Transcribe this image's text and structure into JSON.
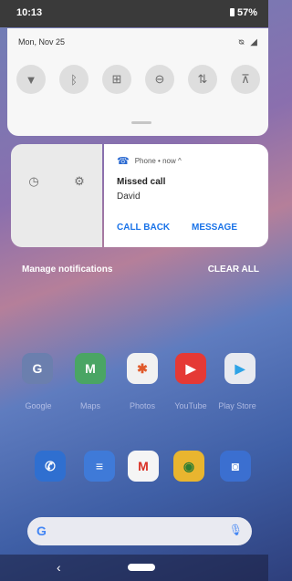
{
  "status_bar": {
    "time": "10:13",
    "battery": "57%"
  },
  "quick_settings": {
    "date": "Mon, Nov 25",
    "status_icons": "ᴓ ◢",
    "tiles": [
      {
        "name": "wifi",
        "glyph": "▼"
      },
      {
        "name": "bluetooth",
        "glyph": "ᛒ"
      },
      {
        "name": "battery-saver",
        "glyph": "⊞"
      },
      {
        "name": "do-not-disturb",
        "glyph": "⊖"
      },
      {
        "name": "data",
        "glyph": "⇅"
      },
      {
        "name": "flashlight",
        "glyph": "⊼"
      }
    ]
  },
  "notification": {
    "app": "Phone • now ^",
    "title": "Missed call",
    "subtitle": "David",
    "actions": {
      "call_back": "CALL BACK",
      "message": "MESSAGE"
    },
    "side_icons": {
      "snooze": "◷",
      "settings": "⚙"
    }
  },
  "footer": {
    "manage": "Manage notifications",
    "clear_all": "CLEAR ALL"
  },
  "home_apps": [
    {
      "label": "Google",
      "color": "#6b7fae",
      "glyph": "G"
    },
    {
      "label": "Maps",
      "color": "#4aa564",
      "glyph": "M"
    },
    {
      "label": "Photos",
      "color": "#f1f1f1",
      "glyph": "✱"
    },
    {
      "label": "YouTube",
      "color": "#e53935",
      "glyph": "▶"
    },
    {
      "label": "Play Store",
      "color": "#e8eaf0",
      "glyph": "▶"
    }
  ],
  "dock_apps": [
    {
      "label": "Phone",
      "color": "#2f6fd0",
      "glyph": "✆"
    },
    {
      "label": "Messages",
      "color": "#3f7ad8",
      "glyph": "≡"
    },
    {
      "label": "Gmail",
      "color": "#f5f5f5",
      "glyph": "M"
    },
    {
      "label": "Chrome",
      "color": "#e9b52f",
      "glyph": "◉"
    },
    {
      "label": "Camera",
      "color": "#3b6fd0",
      "glyph": "◙"
    }
  ],
  "search_bar": {
    "g": "G",
    "mic": "🎙"
  },
  "nav": {
    "back": "‹"
  }
}
